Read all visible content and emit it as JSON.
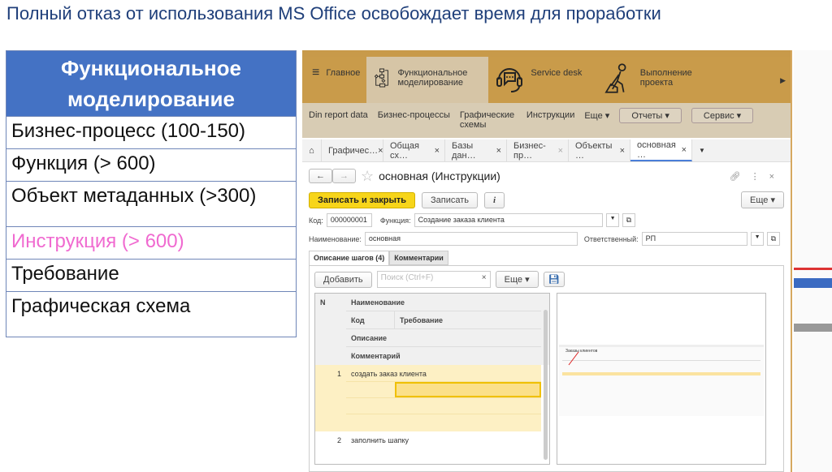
{
  "slide_title": "Полный отказ от использования MS Office освобождает время для проработки",
  "left_table": {
    "header": "Функциональное моделирование",
    "rows": [
      "Бизнес-процесс (100-150)",
      "Функция (> 600)",
      "Объект метаданных (>300)",
      "Инструкция (> 600)",
      "Требование",
      "Графическая схема"
    ],
    "highlight_color": "#f06ad0"
  },
  "app": {
    "sections": [
      "Главное",
      "Функциональное моделирование",
      "Service desk",
      "Выполнение проекта"
    ],
    "subnav": [
      "Din report data",
      "Бизнес-процессы",
      "Графические схемы",
      "Инструкции",
      "Еще ▾"
    ],
    "reports_label": "Отчеты ▾",
    "service_label": "Сервис ▾",
    "tabs": [
      "Графичес…",
      "Общая сх…",
      "Базы дан…",
      "Бизнес-пр…",
      "Объекты …",
      "основная …"
    ],
    "form_title": "основная (Инструкции)",
    "save_close": "Записать и закрыть",
    "save": "Записать",
    "info": "i",
    "more": "Еще ▾",
    "code_label": "Код:",
    "code_value": "000000001",
    "function_label": "Функция:",
    "function_value": "Создание заказа клиента",
    "name_label": "Наименование:",
    "name_value": "основная",
    "responsible_label": "Ответственный:",
    "responsible_value": "РП",
    "inner_tabs": [
      "Описание шагов (4)",
      "Комментарии"
    ],
    "add": "Добавить",
    "search_placeholder": "Поиск (Ctrl+F)",
    "more2": "Еще ▾",
    "columns": {
      "n": "N",
      "name": "Наименование",
      "code": "Код",
      "requirement": "Требование",
      "description": "Описание",
      "comment": "Комментарий"
    },
    "rows": [
      {
        "n": "1",
        "name": "создать заказ клиента"
      },
      {
        "n": "2",
        "name": "заполнить шапку"
      }
    ],
    "preview_title": "Заказы клиентов"
  },
  "accent": "#4472c4"
}
